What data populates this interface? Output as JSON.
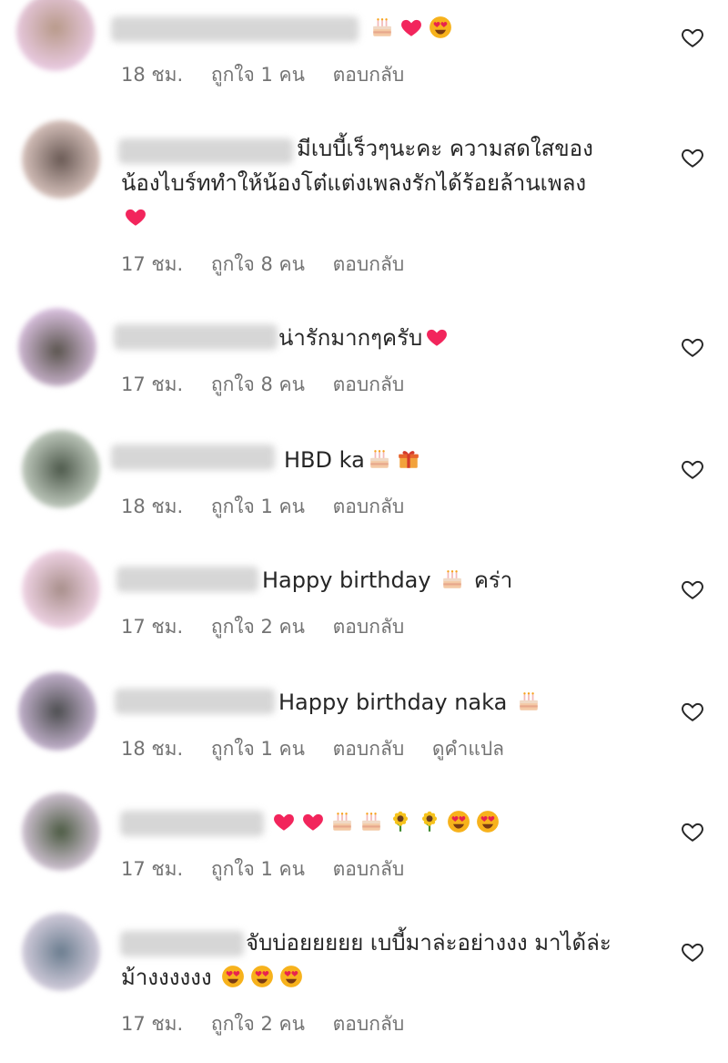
{
  "comments": [
    {
      "text_lines": [
        ""
      ],
      "emoji_after": [
        "cake",
        "heart",
        "heart-eyes"
      ],
      "time": "18 ชม.",
      "likes": "ถูกใจ 1 คน",
      "reply": "ตอบกลับ"
    },
    {
      "text_lines": [
        "มีเบบี้เร็วๆนะคะ ความสดใสของ",
        "น้องไบร์ททำให้น้องโต๋แต่งเพลงรักได้ร้อยล้านเพลง"
      ],
      "emoji_line": [
        "heart"
      ],
      "time": "17 ชม.",
      "likes": "ถูกใจ 8 คน",
      "reply": "ตอบกลับ"
    },
    {
      "text_lines": [
        "น่ารักมากๆครับ"
      ],
      "emoji_after": [
        "heart"
      ],
      "time": "17 ชม.",
      "likes": "ถูกใจ 8 คน",
      "reply": "ตอบกลับ"
    },
    {
      "text_lines": [
        "HBD ka"
      ],
      "emoji_after": [
        "cake",
        "gift"
      ],
      "time": "18 ชม.",
      "likes": "ถูกใจ 1 คน",
      "reply": "ตอบกลับ"
    },
    {
      "text_lines": [
        "Happy birthday"
      ],
      "emoji_after": [
        "cake"
      ],
      "text_suffix": "คร่า",
      "time": "17 ชม.",
      "likes": "ถูกใจ 2 คน",
      "reply": "ตอบกลับ"
    },
    {
      "text_lines": [
        "Happy birthday naka"
      ],
      "emoji_after": [
        "cake"
      ],
      "time": "18 ชม.",
      "likes": "ถูกใจ 1 คน",
      "reply": "ตอบกลับ",
      "translate": "ดูคำแปล"
    },
    {
      "text_lines": [
        ""
      ],
      "emoji_after": [
        "heart",
        "heart",
        "cake",
        "cake",
        "sunflower",
        "sunflower",
        "heart-eyes",
        "heart-eyes"
      ],
      "time": "17 ชม.",
      "likes": "ถูกใจ 1 คน",
      "reply": "ตอบกลับ"
    },
    {
      "text_lines": [
        "จับบ่อยยยยย เบบี้มาล่ะอย่างงง มาได้ล่ะ",
        "ม้างงงงงง"
      ],
      "emoji_after": [
        "heart-eyes",
        "heart-eyes",
        "heart-eyes"
      ],
      "time": "17 ชม.",
      "likes": "ถูกใจ 2 คน",
      "reply": "ตอบกลับ"
    }
  ],
  "icons": {
    "like": "heart-outline-icon"
  },
  "colors": {
    "text": "#262626",
    "meta": "#737373",
    "heart": "#ff2f6d"
  }
}
